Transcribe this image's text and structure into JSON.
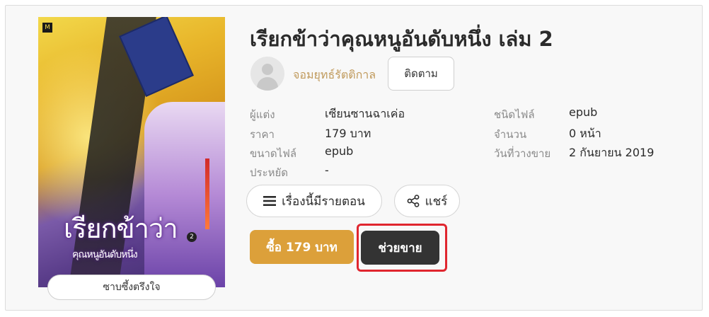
{
  "book": {
    "title": "เรียกข้าว่าคุณหนูอันดับหนึ่ง เล่ม 2",
    "sample_label": "ซาบซึ้งตรึงใจ"
  },
  "author": {
    "name": "จอมยุทธ์รัตติกาล",
    "follow_label": "ติดตาม"
  },
  "meta_left": [
    {
      "label": "ผู้แต่ง",
      "value": "เซียนซานฉาเค่อ"
    },
    {
      "label": "ราคา",
      "value": "179 บาท"
    },
    {
      "label": "ขนาดไฟล์",
      "value": "epub"
    },
    {
      "label": "ประหยัด",
      "value": "-"
    }
  ],
  "meta_right": [
    {
      "label": "ชนิดไฟล์",
      "value": "epub"
    },
    {
      "label": "จำนวน",
      "value": "0 หน้า"
    },
    {
      "label": "วันที่วางขาย",
      "value": "2 กันยายน 2019"
    }
  ],
  "actions": {
    "episodes_label": "เรื่องนี้มีรายตอน",
    "share_label": "แชร์",
    "buy_label": "ซื้อ 179 บาท",
    "help_sell_label": "ช่วยขาย"
  },
  "colors": {
    "accent_gold": "#dca03a",
    "author_link": "#c09a5c",
    "dark_button": "#333333",
    "highlight_red": "#e0262f"
  },
  "icons": {
    "episodes": "list-icon",
    "share": "share-icon",
    "avatar": "user-avatar-icon"
  }
}
